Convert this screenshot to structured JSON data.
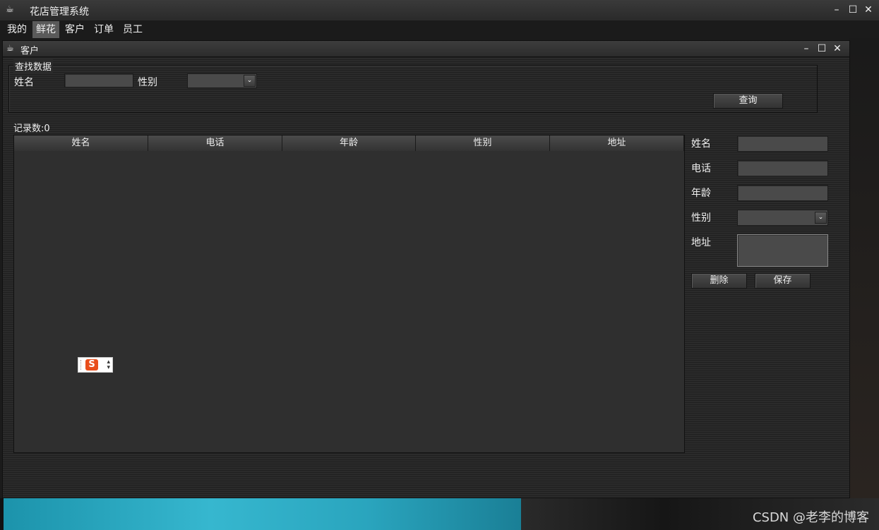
{
  "app": {
    "title": "花店管理系统",
    "icon": "teacup-icon",
    "controls": {
      "minimize": "–",
      "maximize": "☐",
      "close": "✕"
    }
  },
  "menu": {
    "items": [
      {
        "label": "我的",
        "active": false
      },
      {
        "label": "鲜花",
        "active": true
      },
      {
        "label": "客户",
        "active": false
      },
      {
        "label": "订单",
        "active": false
      },
      {
        "label": "员工",
        "active": false
      }
    ]
  },
  "child_window": {
    "title": "客户",
    "icon": "teacup-icon",
    "controls": {
      "minimize": "–",
      "maximize": "☐",
      "close": "✕"
    }
  },
  "search": {
    "group_title": "查找数据",
    "name_label": "姓名",
    "name_value": "",
    "gender_label": "性别",
    "gender_value": "",
    "query_button": "查询"
  },
  "records": {
    "count_label": "记录数:0"
  },
  "table": {
    "columns": [
      "姓名",
      "电话",
      "年龄",
      "性别",
      "地址"
    ],
    "rows": []
  },
  "form": {
    "name_label": "姓名",
    "phone_label": "电话",
    "age_label": "年龄",
    "gender_label": "性别",
    "address_label": "地址",
    "name_value": "",
    "phone_value": "",
    "age_value": "",
    "gender_value": "",
    "address_value": "",
    "delete_button": "删除",
    "save_button": "保存"
  },
  "ime": {
    "logo": "S"
  },
  "watermark": "CSDN @老李的博客",
  "colors": {
    "window_bg": "#2a2a2a",
    "input_bg": "#4a4a4a",
    "ime_orange": "#e94e1b",
    "desktop_teal": "#36b7cf"
  }
}
